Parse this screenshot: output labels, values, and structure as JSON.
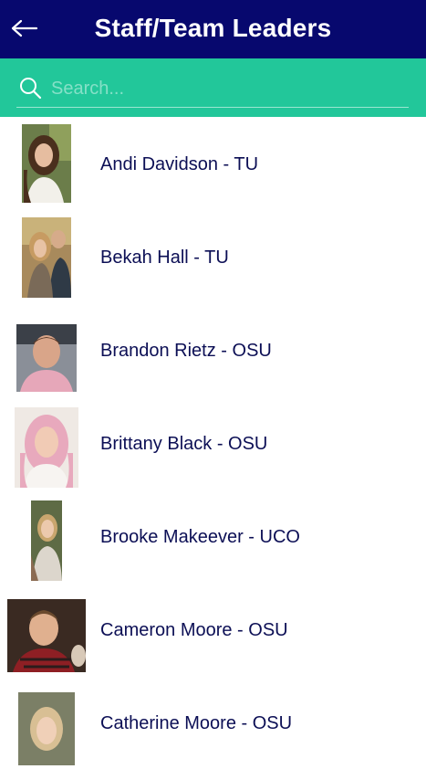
{
  "header": {
    "title": "Staff/Team Leaders",
    "background": "#07086e"
  },
  "search": {
    "placeholder": "Search...",
    "value": "",
    "background": "#22c79a"
  },
  "people": [
    {
      "name": "Andi Davidson - TU"
    },
    {
      "name": "Bekah Hall - TU"
    },
    {
      "name": "Brandon Rietz - OSU"
    },
    {
      "name": "Brittany Black - OSU"
    },
    {
      "name": "Brooke Makeever - UCO"
    },
    {
      "name": "Cameron Moore - OSU"
    },
    {
      "name": "Catherine Moore - OSU"
    }
  ]
}
